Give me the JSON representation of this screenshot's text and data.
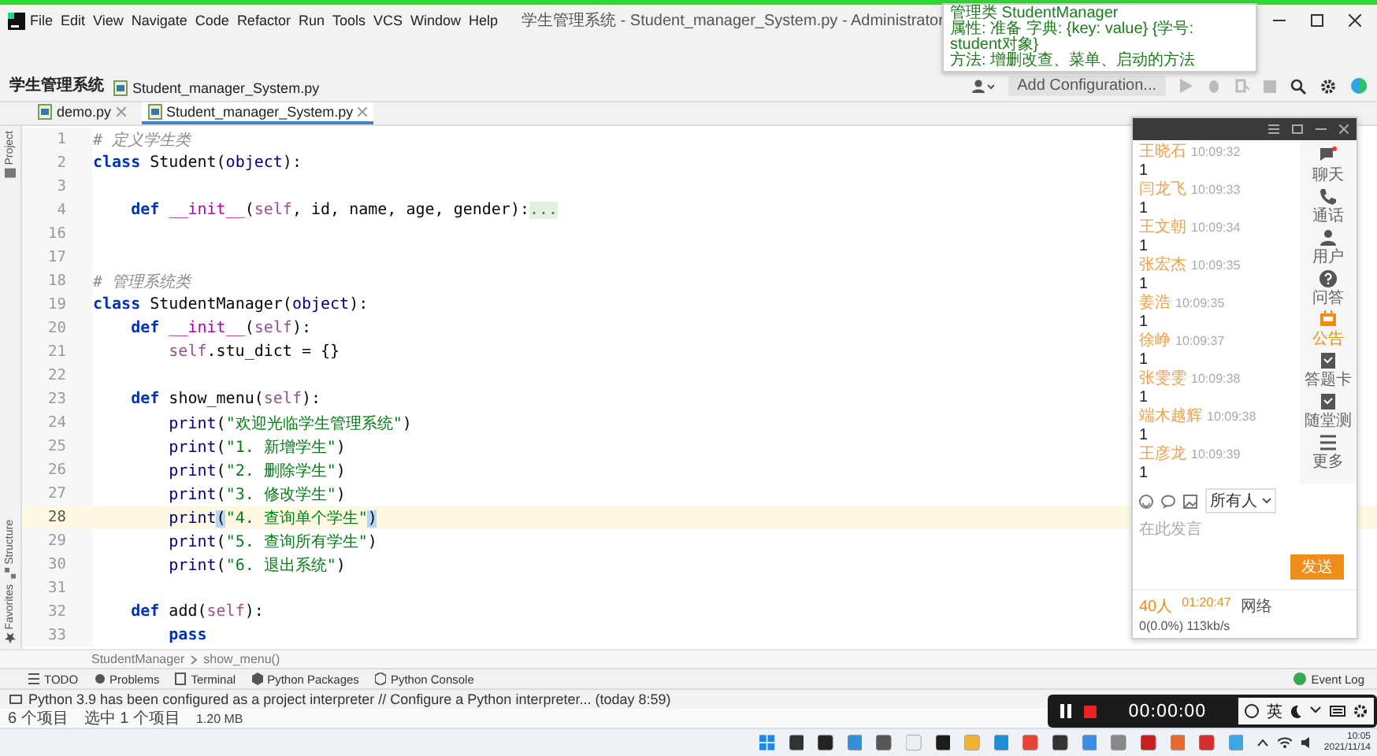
{
  "window": {
    "title": "学生管理系统 - Student_manager_System.py - Administrator",
    "menus": [
      "File",
      "Edit",
      "View",
      "Navigate",
      "Code",
      "Refactor",
      "Run",
      "Tools",
      "VCS",
      "Window",
      "Help"
    ]
  },
  "tooltip": {
    "lines": [
      "管理类 StudentManager",
      "属性: 准备 字典: {key: value} {学号: student对象}",
      "方法: 增删改查、菜单、启动的方法"
    ]
  },
  "navigation": {
    "project": "学生管理系统",
    "file": "Student_manager_System.py",
    "run_config": "Add Configuration..."
  },
  "tabs": [
    {
      "label": "demo.py",
      "selected": false
    },
    {
      "label": "Student_manager_System.py",
      "selected": true
    }
  ],
  "side_tools": [
    "Project",
    "Structure",
    "Favorites"
  ],
  "editor": {
    "lines": [
      {
        "number": "1",
        "current": false,
        "tokens": [
          {
            "kind": "comment",
            "text": "# 定义学生类"
          }
        ]
      },
      {
        "number": "2",
        "current": false,
        "tokens": [
          {
            "kind": "keyword",
            "text": "class"
          },
          {
            "kind": "plain",
            "text": " Student("
          },
          {
            "kind": "builtin",
            "text": "object"
          },
          {
            "kind": "plain",
            "text": "):"
          }
        ]
      },
      {
        "number": "3",
        "current": false
      },
      {
        "number": "4",
        "current": false,
        "tokens": [
          {
            "kind": "keyword",
            "text": "    def"
          },
          {
            "kind": "magic",
            "text": " __init__"
          },
          {
            "kind": "plain",
            "text": "("
          },
          {
            "kind": "self",
            "text": "self"
          },
          {
            "kind": "plain",
            "text": ", id, name, age, gender):"
          },
          {
            "kind": "folded",
            "text": "..."
          }
        ]
      },
      {
        "number": "16",
        "current": false
      },
      {
        "number": "17",
        "current": false
      },
      {
        "number": "18",
        "current": false,
        "tokens": [
          {
            "kind": "comment",
            "text": "# 管理系统类"
          }
        ]
      },
      {
        "number": "19",
        "current": false,
        "tokens": [
          {
            "kind": "keyword",
            "text": "class"
          },
          {
            "kind": "plain",
            "text": " StudentManager("
          },
          {
            "kind": "builtin",
            "text": "object"
          },
          {
            "kind": "plain",
            "text": "):"
          }
        ]
      },
      {
        "number": "20",
        "current": false,
        "tokens": [
          {
            "kind": "keyword",
            "text": "    def"
          },
          {
            "kind": "magic",
            "text": " __init__"
          },
          {
            "kind": "plain",
            "text": "("
          },
          {
            "kind": "self",
            "text": "self"
          },
          {
            "kind": "plain",
            "text": "):"
          }
        ]
      },
      {
        "number": "21",
        "current": false,
        "tokens": [
          {
            "kind": "self",
            "text": "        self"
          },
          {
            "kind": "plain",
            "text": ".stu_dict = {}"
          }
        ]
      },
      {
        "number": "22",
        "current": false
      },
      {
        "number": "23",
        "current": false,
        "tokens": [
          {
            "kind": "keyword",
            "text": "    def"
          },
          {
            "kind": "plain",
            "text": " show_menu("
          },
          {
            "kind": "self",
            "text": "self"
          },
          {
            "kind": "plain",
            "text": "):"
          }
        ]
      },
      {
        "number": "24",
        "current": false,
        "tokens": [
          {
            "kind": "builtin",
            "text": "        print"
          },
          {
            "kind": "plain",
            "text": "("
          },
          {
            "kind": "string",
            "text": "\"欢迎光临学生管理系统\""
          },
          {
            "kind": "plain",
            "text": ")"
          }
        ]
      },
      {
        "number": "25",
        "current": false,
        "tokens": [
          {
            "kind": "builtin",
            "text": "        print"
          },
          {
            "kind": "plain",
            "text": "("
          },
          {
            "kind": "string",
            "text": "\"1. 新增学生\""
          },
          {
            "kind": "plain",
            "text": ")"
          }
        ]
      },
      {
        "number": "26",
        "current": false,
        "tokens": [
          {
            "kind": "builtin",
            "text": "        print"
          },
          {
            "kind": "plain",
            "text": "("
          },
          {
            "kind": "string",
            "text": "\"2. 删除学生\""
          },
          {
            "kind": "plain",
            "text": ")"
          }
        ]
      },
      {
        "number": "27",
        "current": false,
        "tokens": [
          {
            "kind": "builtin",
            "text": "        print"
          },
          {
            "kind": "plain",
            "text": "("
          },
          {
            "kind": "string",
            "text": "\"3. 修改学生\""
          },
          {
            "kind": "plain",
            "text": ")"
          }
        ]
      },
      {
        "number": "28",
        "current": true,
        "tokens": [
          {
            "kind": "builtin",
            "text": "        print"
          },
          {
            "kind": "match",
            "text": "("
          },
          {
            "kind": "string",
            "text": "\"4. 查询单个学生\""
          },
          {
            "kind": "match",
            "text": ")"
          }
        ]
      },
      {
        "number": "29",
        "current": false,
        "tokens": [
          {
            "kind": "builtin",
            "text": "        print"
          },
          {
            "kind": "plain",
            "text": "("
          },
          {
            "kind": "string",
            "text": "\"5. 查询所有学生\""
          },
          {
            "kind": "plain",
            "text": ")"
          }
        ]
      },
      {
        "number": "30",
        "current": false,
        "tokens": [
          {
            "kind": "builtin",
            "text": "        print"
          },
          {
            "kind": "plain",
            "text": "("
          },
          {
            "kind": "string",
            "text": "\"6. 退出系统\""
          },
          {
            "kind": "plain",
            "text": ")"
          }
        ]
      },
      {
        "number": "31",
        "current": false
      },
      {
        "number": "32",
        "current": false,
        "tokens": [
          {
            "kind": "keyword",
            "text": "    def"
          },
          {
            "kind": "plain",
            "text": " add("
          },
          {
            "kind": "self",
            "text": "self"
          },
          {
            "kind": "plain",
            "text": "):"
          }
        ]
      },
      {
        "number": "33",
        "current": false,
        "tokens": [
          {
            "kind": "keyword",
            "text": "        pass"
          }
        ]
      }
    ]
  },
  "breadcrumb": [
    "StudentManager",
    "show_menu()"
  ],
  "tool_windows": [
    "TODO",
    "Problems",
    "Terminal",
    "Python Packages",
    "Python Console"
  ],
  "event_log": "Event Log",
  "status": "Python 3.9 has been configured as a project interpreter // Configure a Python interpreter... (today 8:59)",
  "explorer_status": [
    "6 个项目",
    "选中 1 个项目",
    "1.20 MB"
  ],
  "chat": {
    "messages": [
      {
        "name": "王晓石",
        "time": "10:09:32",
        "text": "1"
      },
      {
        "name": "闫龙飞",
        "time": "10:09:33",
        "text": "1"
      },
      {
        "name": "王文朝",
        "time": "10:09:34",
        "text": "1"
      },
      {
        "name": "张宏杰",
        "time": "10:09:35",
        "text": "1"
      },
      {
        "name": "姜浩",
        "time": "10:09:35",
        "text": "1"
      },
      {
        "name": "徐峥",
        "time": "10:09:37",
        "text": "1"
      },
      {
        "name": "张雯雯",
        "time": "10:09:38",
        "text": "1"
      },
      {
        "name": "端木越辉",
        "time": "10:09:38",
        "text": "1"
      },
      {
        "name": "王彦龙",
        "time": "10:09:39",
        "text": "1"
      }
    ],
    "tabs": [
      {
        "label": "聊天",
        "selected": false
      },
      {
        "label": "通话",
        "selected": false
      },
      {
        "label": "用户",
        "selected": false
      },
      {
        "label": "问答",
        "selected": false
      },
      {
        "label": "公告",
        "selected": true
      },
      {
        "label": "答题卡",
        "selected": false
      },
      {
        "label": "随堂测",
        "selected": false
      },
      {
        "label": "更多",
        "selected": false
      }
    ],
    "recipient": "所有人",
    "placeholder": "在此发言",
    "send": "发送",
    "footer": {
      "people": "40人",
      "duration": "01:20:47",
      "network_label": "网络",
      "network": "0(0.0%) 113kb/s"
    }
  },
  "recorder": {
    "time": "00:00:00",
    "ime": "英"
  },
  "clock": {
    "time": "10:05",
    "date": "2021/11/14"
  }
}
